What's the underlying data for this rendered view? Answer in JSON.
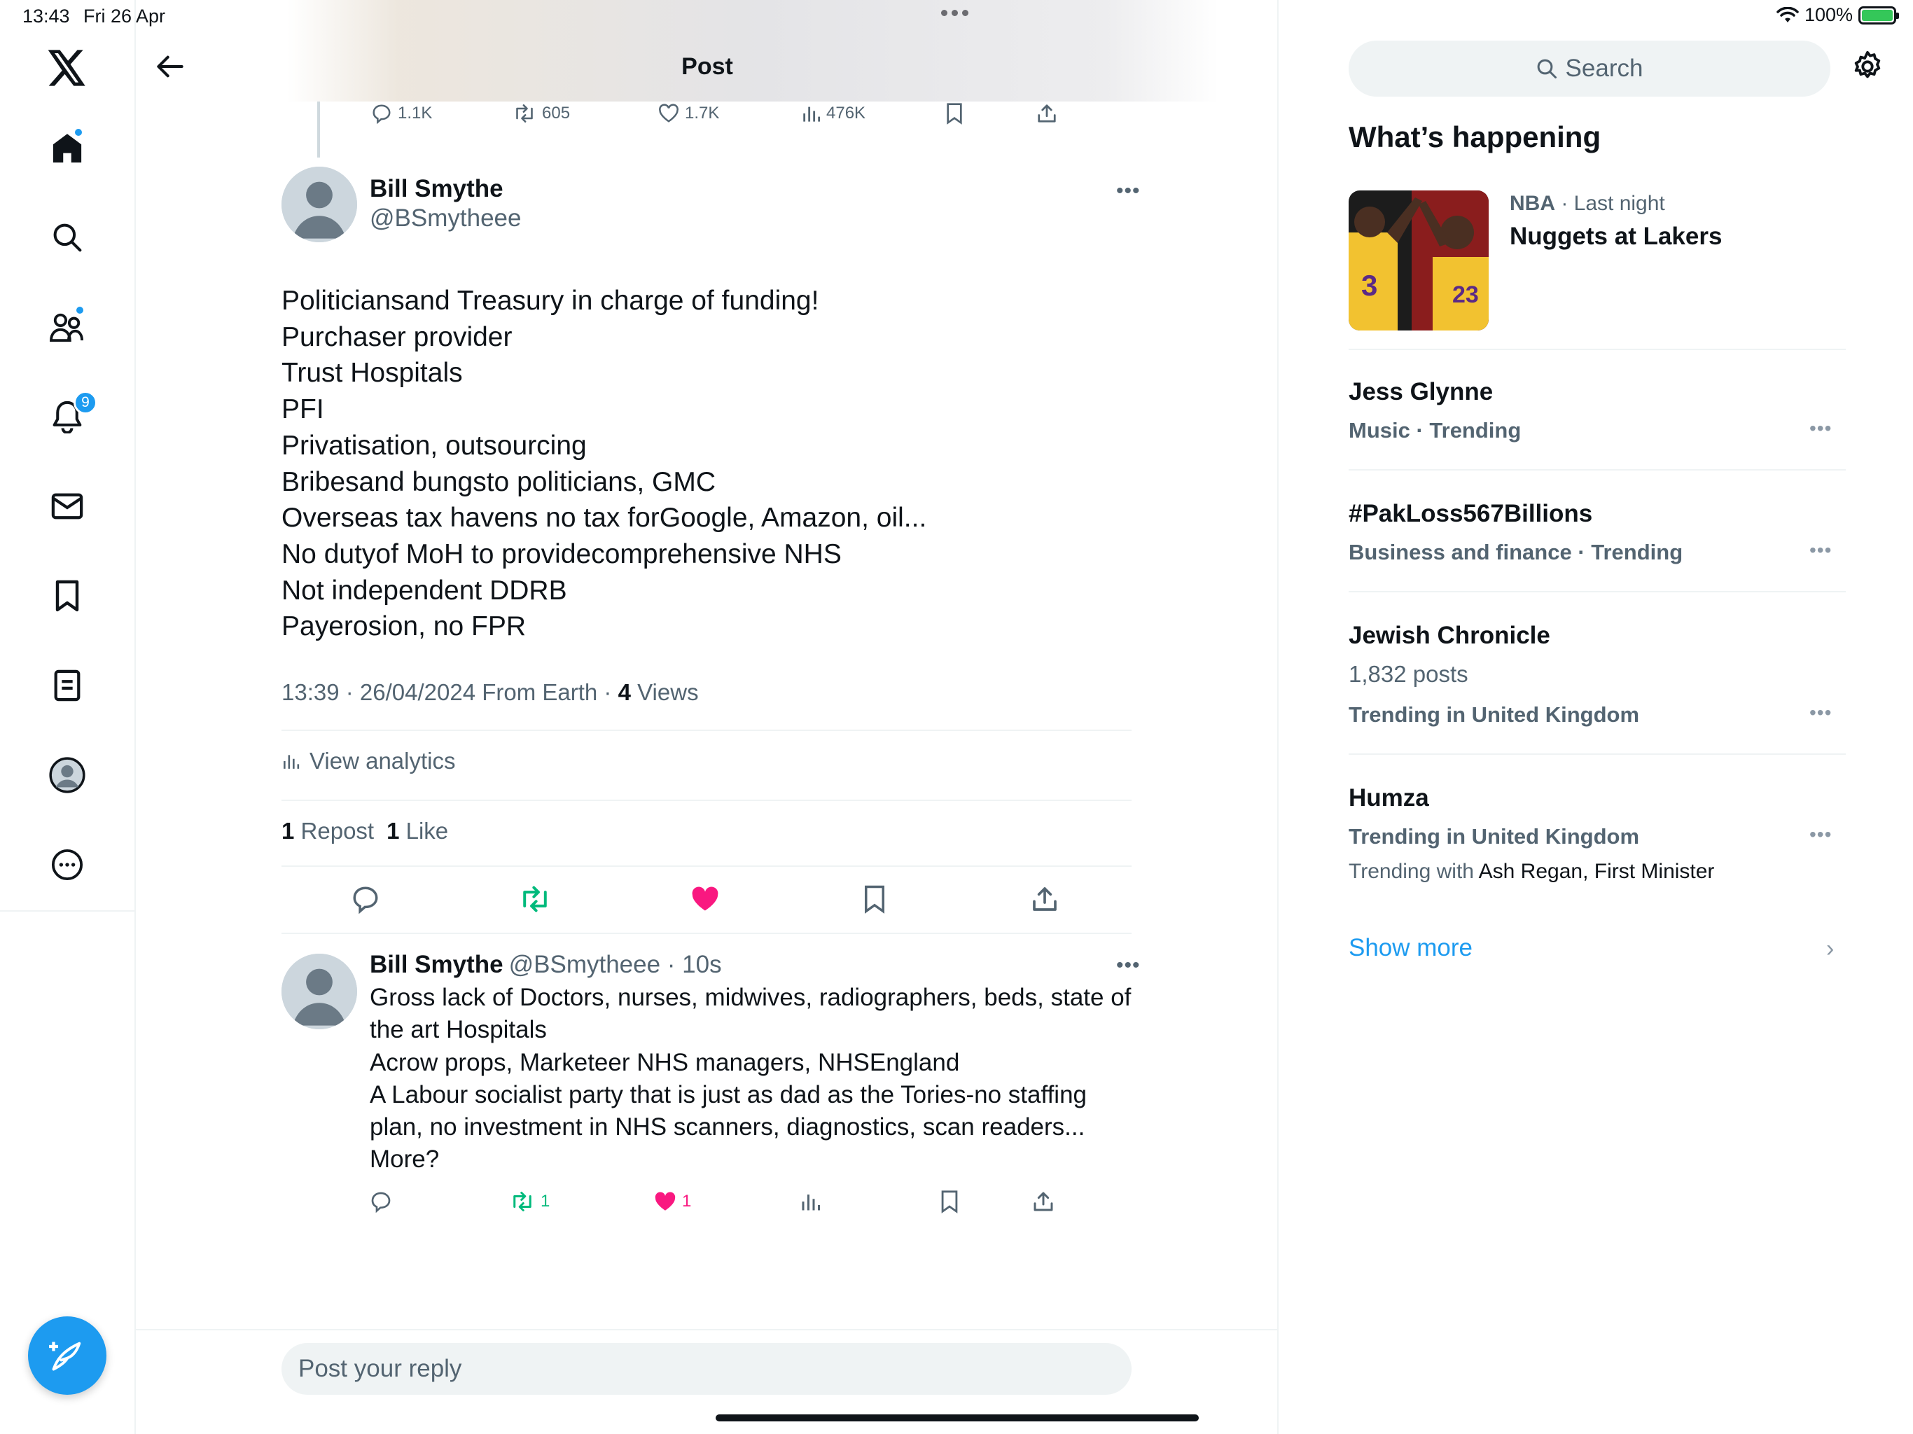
{
  "status_bar": {
    "time": "13:43",
    "date": "Fri 26 Apr",
    "battery": "100%"
  },
  "nav": {
    "notifications_badge": "9"
  },
  "header": {
    "title": "Post"
  },
  "parent_post_actions": {
    "replies": "1.1K",
    "reposts": "605",
    "likes": "1.7K",
    "views": "476K"
  },
  "post": {
    "author_name": "Bill Smythe",
    "author_handle": "@BSmytheee",
    "lines": [
      "Politiciansand Treasury in charge of funding!",
      "Purchaser provider",
      "Trust Hospitals",
      "PFI",
      "Privatisation, outsourcing",
      "Bribesand bungsto politicians, GMC",
      "Overseas tax havens no tax forGoogle, Amazon, oil...",
      "No dutyof MoH to providecomprehensive NHS",
      "Not independent DDRB",
      "Payerosion, no FPR"
    ],
    "timestamp": "13:39 · 26/04/2024 From Earth · ",
    "views_count": "4",
    "views_label": " Views",
    "view_analytics": "View analytics",
    "repost_count": "1",
    "repost_label": "Repost",
    "like_count": "1",
    "like_label": "Like"
  },
  "reply": {
    "author_name": "Bill Smythe",
    "author_handle": "@BSmytheee · 10s",
    "lines": [
      "Gross lack of Doctors, nurses, midwives, radiographers, beds, state of",
      "the art Hospitals",
      "Acrow props, Marketeer NHS managers, NHSEngland",
      "A Labour socialist party that is just as dad as the Tories-no staffing",
      "plan, no investment in NHS scanners, diagnostics, scan readers...",
      "More?"
    ],
    "repost_count": "1",
    "like_count": "1"
  },
  "reply_box": {
    "placeholder": "Post your reply"
  },
  "sidebar": {
    "search_placeholder": "Search",
    "section_title": "What’s happening",
    "news": {
      "category": "NBA",
      "time": " · Last night",
      "title": "Nuggets at Lakers"
    },
    "trends": [
      {
        "title": "Jess Glynne",
        "subtitle": "Music · Trending"
      },
      {
        "title": "#PakLoss567Billions",
        "subtitle": "Business and finance · Trending"
      },
      {
        "title": "Jewish Chronicle",
        "count": "1,832 posts",
        "subtitle": "Trending in United Kingdom"
      },
      {
        "title": "Humza",
        "subtitle": "Trending in United Kingdom",
        "with_prefix": "Trending with ",
        "with_terms": "Ash Regan, First Minister"
      }
    ],
    "show_more": "Show more"
  },
  "colors": {
    "accent": "#1d9bf0",
    "repost_green": "#00ba7c",
    "like_pink": "#f91880",
    "secondary_text": "#536471"
  }
}
